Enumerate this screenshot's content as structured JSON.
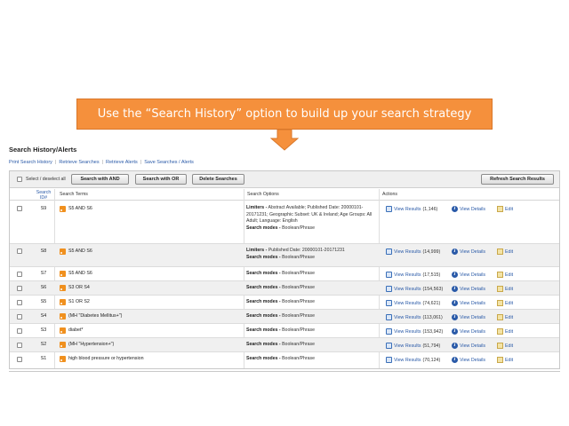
{
  "callout": {
    "text": "Use the “Search History” option to build up your search strategy"
  },
  "page": {
    "title": "Search History/Alerts"
  },
  "links": [
    "Print Search History",
    "Retrieve Searches",
    "Retrieve Alerts",
    "Save Searches / Alerts"
  ],
  "toolbar": {
    "select_all_label": "Select / deselect all",
    "search_and": "Search with AND",
    "search_or": "Search with OR",
    "delete": "Delete Searches",
    "refresh": "Refresh Search Results"
  },
  "columns": {
    "search_id": "Search ID#",
    "search_terms": "Search Terms",
    "search_options": "Search Options",
    "actions": "Actions"
  },
  "action_labels": {
    "view_results": "View Results",
    "view_details": "View Details",
    "edit": "Edit"
  },
  "rows": [
    {
      "id": "S9",
      "terms": "S5 AND S6",
      "limiters_label": "Limiters -",
      "limiters": "Abstract Available; Published Date: 20000101-20171231; Geographic Subset: UK & Ireland; Age Groups: All Adult; Language: English",
      "modes_label": "Search modes -",
      "modes": "Boolean/Phrase",
      "count": "(1,146)"
    },
    {
      "id": "S8",
      "terms": "S5 AND S6",
      "limiters_label": "Limiters -",
      "limiters": "Published Date: 20000101-20171231",
      "modes_label": "Search modes -",
      "modes": "Boolean/Phrase",
      "count": "(14,999)"
    },
    {
      "id": "S7",
      "terms": "S5 AND S6",
      "modes_label": "Search modes -",
      "modes": "Boolean/Phrase",
      "count": "(17,515)"
    },
    {
      "id": "S6",
      "terms": "S3 OR S4",
      "modes_label": "Search modes -",
      "modes": "Boolean/Phrase",
      "count": "(154,563)"
    },
    {
      "id": "S5",
      "terms": "S1 OR S2",
      "modes_label": "Search modes -",
      "modes": "Boolean/Phrase",
      "count": "(74,621)"
    },
    {
      "id": "S4",
      "terms": "(MH \"Diabetes Mellitus+\")",
      "modes_label": "Search modes -",
      "modes": "Boolean/Phrase",
      "count": "(113,061)"
    },
    {
      "id": "S3",
      "terms": "diabet*",
      "modes_label": "Search modes -",
      "modes": "Boolean/Phrase",
      "count": "(153,942)"
    },
    {
      "id": "S2",
      "terms": "(MH \"Hypertension+\")",
      "modes_label": "Search modes -",
      "modes": "Boolean/Phrase",
      "count": "(51,794)"
    },
    {
      "id": "S1",
      "terms": "high blood pressure or hypertension",
      "modes_label": "Search modes -",
      "modes": "Boolean/Phrase",
      "count": "(70,124)"
    }
  ],
  "colors": {
    "callout_bg": "#f5903c",
    "link": "#2a5aa8",
    "rss": "#f0901e"
  },
  "icons": [
    "rss-icon",
    "view-results-icon",
    "info-icon",
    "edit-icon",
    "down-arrow-icon"
  ]
}
